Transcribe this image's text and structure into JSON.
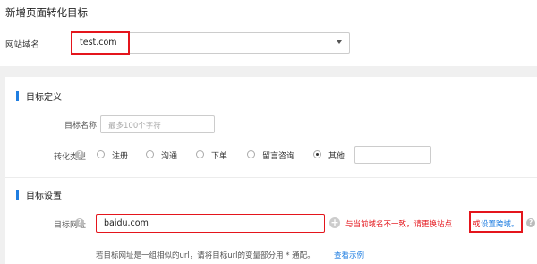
{
  "header": {
    "title": "新增页面转化目标",
    "domain_label": "网站域名",
    "domain_value": "test.com"
  },
  "definition": {
    "section_title": "目标定义",
    "name_label": "目标名称",
    "name_placeholder": "最多100个字符",
    "type_label": "转化类型",
    "type_options": [
      "注册",
      "沟通",
      "下单",
      "留言咨询",
      "其他"
    ],
    "selected_type": "其他"
  },
  "settings": {
    "section_title": "目标设置",
    "url_label": "目标网址",
    "url_value": "baidu.com",
    "error_text": "与当前域名不一致，请更换站点",
    "or_text": "或",
    "cross_domain_link": "设置跨域。",
    "hint_text": "若目标网址是一组相似的url，请将目标url的变量部分用 * 通配。",
    "example_link": "查看示例"
  },
  "colors": {
    "accent": "#1f7ee1",
    "error": "#e4151c"
  }
}
